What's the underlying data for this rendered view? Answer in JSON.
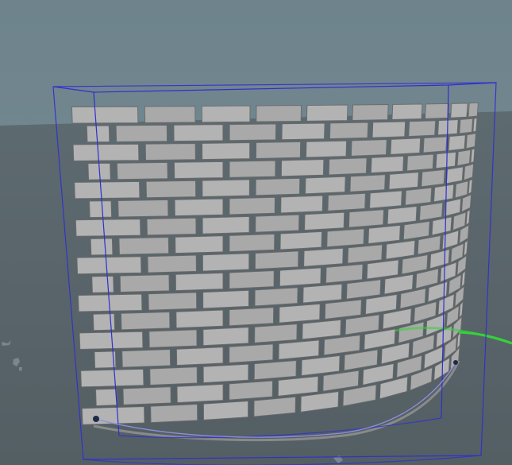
{
  "app": {
    "view": "3d-viewport",
    "selected_object": "curved-brick-wall"
  },
  "colors": {
    "sky_top": "#6e838c",
    "sky_bottom": "#71868f",
    "ground_top": "#5d6a70",
    "ground_bottom": "#545f64",
    "brick_face": "#a9a9a9",
    "brick_face_light": "#b3b3b3",
    "brick_outline": "#6a6a6a",
    "bounding_box": "#2f2fcf",
    "selection_curve": "#8f8fe0",
    "handle": "#1f2a44",
    "gizmo_green": "#35d23a"
  },
  "icons": [
    "bounding-box-icon",
    "handle-point-icon",
    "transform-gizmo-icon"
  ],
  "wall": {
    "rows": 17,
    "bricks_per_row": 10
  }
}
